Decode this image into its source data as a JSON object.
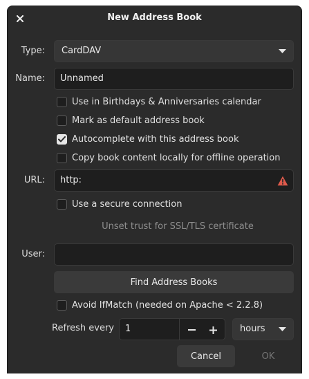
{
  "window": {
    "title": "New Address Book"
  },
  "type_field": {
    "label": "Type:",
    "value": "CardDAV"
  },
  "name_field": {
    "label": "Name:",
    "value": "Unnamed"
  },
  "options": [
    {
      "label": "Use in Birthdays & Anniversaries calendar",
      "checked": false
    },
    {
      "label": "Mark as default address book",
      "checked": false
    },
    {
      "label": "Autocomplete with this address book",
      "checked": true
    },
    {
      "label": "Copy book content locally for offline operation",
      "checked": false
    }
  ],
  "url_field": {
    "label": "URL:",
    "value": "http:",
    "warning_icon": "warning-icon"
  },
  "secure": {
    "label": "Use a secure connection",
    "checked": false
  },
  "ssl_trust": {
    "label": "Unset trust for SSL/TLS certificate"
  },
  "user_field": {
    "label": "User:",
    "value": ""
  },
  "find_button": {
    "label": "Find Address Books"
  },
  "ifmatch": {
    "label": "Avoid IfMatch (needed on Apache < 2.2.8)",
    "checked": false
  },
  "refresh": {
    "label": "Refresh every",
    "value": "1",
    "unit": "hours"
  },
  "buttons": {
    "cancel": "Cancel",
    "ok": "OK"
  },
  "colors": {
    "background": "#2b2b2b",
    "field": "#1e1e1e",
    "button": "#3a3a3a",
    "warning": "#e05a4b"
  }
}
